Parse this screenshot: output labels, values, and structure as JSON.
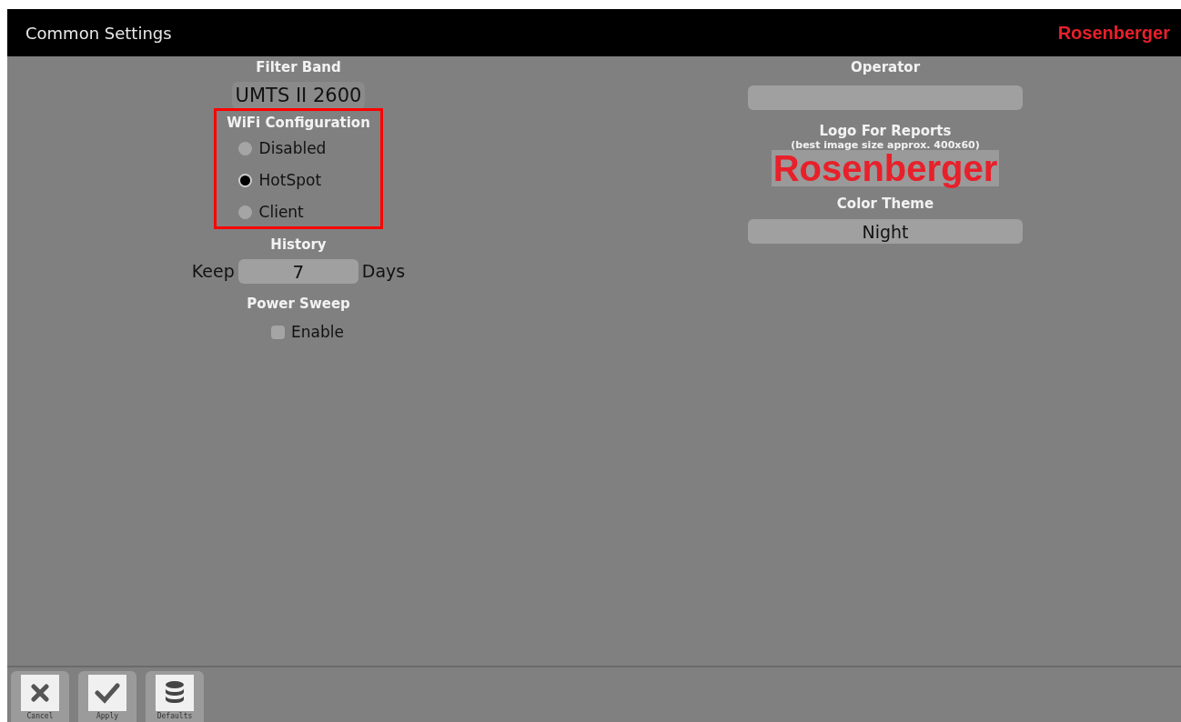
{
  "window": {
    "title": "Common Settings",
    "brand": "Rosenberger"
  },
  "left": {
    "filter_band": {
      "label": "Filter Band",
      "value": "UMTS II 2600"
    },
    "wifi": {
      "label": "WiFi Configuration",
      "options": [
        {
          "label": "Disabled",
          "selected": false
        },
        {
          "label": "HotSpot",
          "selected": true
        },
        {
          "label": "Client",
          "selected": false
        }
      ]
    },
    "history": {
      "label": "History",
      "prefix": "Keep",
      "value": "7",
      "suffix": "Days"
    },
    "power_sweep": {
      "label": "Power Sweep",
      "option": {
        "label": "Enable",
        "checked": false
      }
    }
  },
  "right": {
    "operator": {
      "label": "Operator"
    },
    "logo": {
      "label": "Logo For Reports",
      "hint": "(best image size approx. 400x60)",
      "image_text": "Rosenberger"
    },
    "color_theme": {
      "label": "Color Theme",
      "value": "Night"
    }
  },
  "toolbar": [
    {
      "kind": "cancel",
      "label": "Cancel"
    },
    {
      "kind": "apply",
      "label": "Apply"
    },
    {
      "kind": "defaults",
      "label": "Defaults"
    }
  ]
}
